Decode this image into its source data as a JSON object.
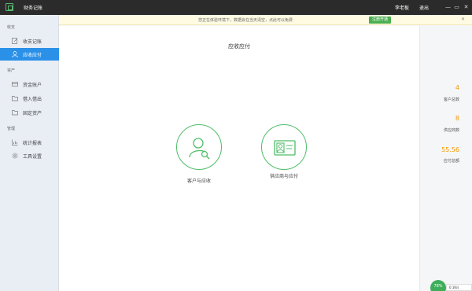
{
  "app": {
    "title": "财务记账",
    "user": "李老板",
    "logout": "退出"
  },
  "window": {
    "minimize": "—",
    "maximize": "▭",
    "close": "✕"
  },
  "notice": {
    "text": "您正在体验环境下，数据会在当天清空，点此可以免费",
    "button": "注册开通",
    "close": "✕"
  },
  "sidebar": {
    "sections": [
      {
        "title": "收支",
        "items": [
          {
            "label": "收支记账",
            "icon": "edit-icon",
            "active": false
          },
          {
            "label": "应收应付",
            "icon": "user-icon",
            "active": true
          }
        ]
      },
      {
        "title": "资产",
        "items": [
          {
            "label": "资金账户",
            "icon": "card-icon",
            "active": false
          },
          {
            "label": "借入借出",
            "icon": "folder-icon",
            "active": false
          },
          {
            "label": "固定资产",
            "icon": "folder-icon",
            "active": false
          }
        ]
      },
      {
        "title": "管理",
        "items": [
          {
            "label": "统计报表",
            "icon": "chart-icon",
            "active": false
          },
          {
            "label": "工具设置",
            "icon": "gear-icon",
            "active": false
          }
        ]
      }
    ]
  },
  "main": {
    "title": "应收应付",
    "cards": [
      {
        "label": "客户与应收",
        "icon": "customer-search-icon"
      },
      {
        "label": "供应商与应付",
        "icon": "supplier-card-icon"
      }
    ]
  },
  "stats": [
    {
      "value": "4",
      "label": "客户总数"
    },
    {
      "value": "8",
      "label": "供应商数"
    },
    {
      "value": "55.56",
      "label": "应付总额"
    }
  ],
  "widget": {
    "gauge": "78%",
    "speed": "0.1K/s"
  },
  "colors": {
    "accent": "#2b90e8",
    "green": "#4fbd68",
    "orange": "#f39800"
  }
}
